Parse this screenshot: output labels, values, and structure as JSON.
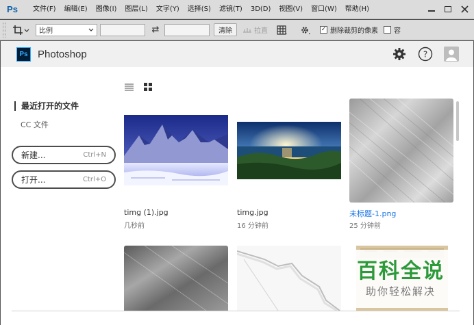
{
  "menubar": {
    "logo": "Ps",
    "items": [
      "文件(F)",
      "编辑(E)",
      "图像(I)",
      "图层(L)",
      "文字(Y)",
      "选择(S)",
      "滤镜(T)",
      "3D(D)",
      "视图(V)",
      "窗口(W)",
      "帮助(H)"
    ]
  },
  "options": {
    "ratio_select": "比例",
    "clear_button": "清除",
    "straighten_label": "拉直",
    "delete_cropped_label": "删除裁剪的像素",
    "content_aware_label": "容"
  },
  "workspace": {
    "logo": "Ps",
    "app_name": "Photoshop",
    "sidebar": {
      "recent_label": "最近打开的文件",
      "cc_label": "CC 文件",
      "new_button": {
        "label": "新建...",
        "shortcut": "Ctrl+N"
      },
      "open_button": {
        "label": "打开...",
        "shortcut": "Ctrl+O"
      }
    },
    "files": [
      {
        "name": "timg (1).jpg",
        "time": "几秒前"
      },
      {
        "name": "timg.jpg",
        "time": "16 分钟前"
      },
      {
        "name": "未标题-1.png",
        "time": "25 分钟前"
      }
    ]
  },
  "watermark": {
    "main": "百科全说",
    "sub": "助你轻松解决"
  },
  "colors": {
    "accent": "#1473e6",
    "ps_blue": "#31a8ff",
    "watermark_green": "#2c9a3a"
  }
}
